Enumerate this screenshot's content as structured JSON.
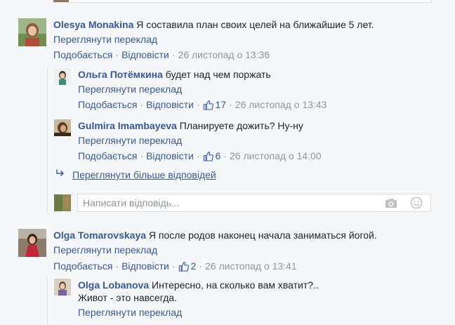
{
  "comments": [
    {
      "author": "Olesya Monakina",
      "text": "Я составила план своих целей на ближайшие 5 лет.",
      "translate": "Переглянути переклад",
      "like": "Подобається",
      "reply": "Відповісти",
      "time": "26 листопад о 13:36",
      "replies": [
        {
          "author": "Ольга Потёмкина",
          "text": "будет над чем поржать",
          "translate": "Переглянути переклад",
          "like": "Подобається",
          "reply": "Відповісти",
          "likes": "17",
          "time": "26 листопад о 13:43"
        },
        {
          "author": "Gulmira Imambayeva",
          "text": "Планируете дожить? Ну-ну",
          "translate": "Переглянути переклад",
          "like": "Подобається",
          "reply": "Відповісти",
          "likes": "6",
          "time": "26 листопад о 14:00"
        }
      ],
      "more_replies": "Переглянути більше відповідей",
      "reply_placeholder": "Написати відповідь..."
    },
    {
      "author": "Olga Tomarovskaya",
      "text": "Я после родов наконец начала заниматься йогой.",
      "translate": "Переглянути переклад",
      "like": "Подобається",
      "reply": "Відповісти",
      "likes": "2",
      "time": "26 листопад о 13:41",
      "replies": [
        {
          "author": "Olga Lobanova",
          "text_line1": "Интересно, на сколько вам хватит?..",
          "text_line2": "Живот - это навсегда.",
          "translate": "Переглянути переклад"
        }
      ]
    }
  ],
  "colors": {
    "link": "#365899",
    "meta": "#90949c",
    "background": "#f6f7f9",
    "border": "#dddfe2"
  },
  "icons": [
    "thumbs-up-icon",
    "reply-arrow-icon",
    "camera-icon",
    "smiley-icon"
  ]
}
